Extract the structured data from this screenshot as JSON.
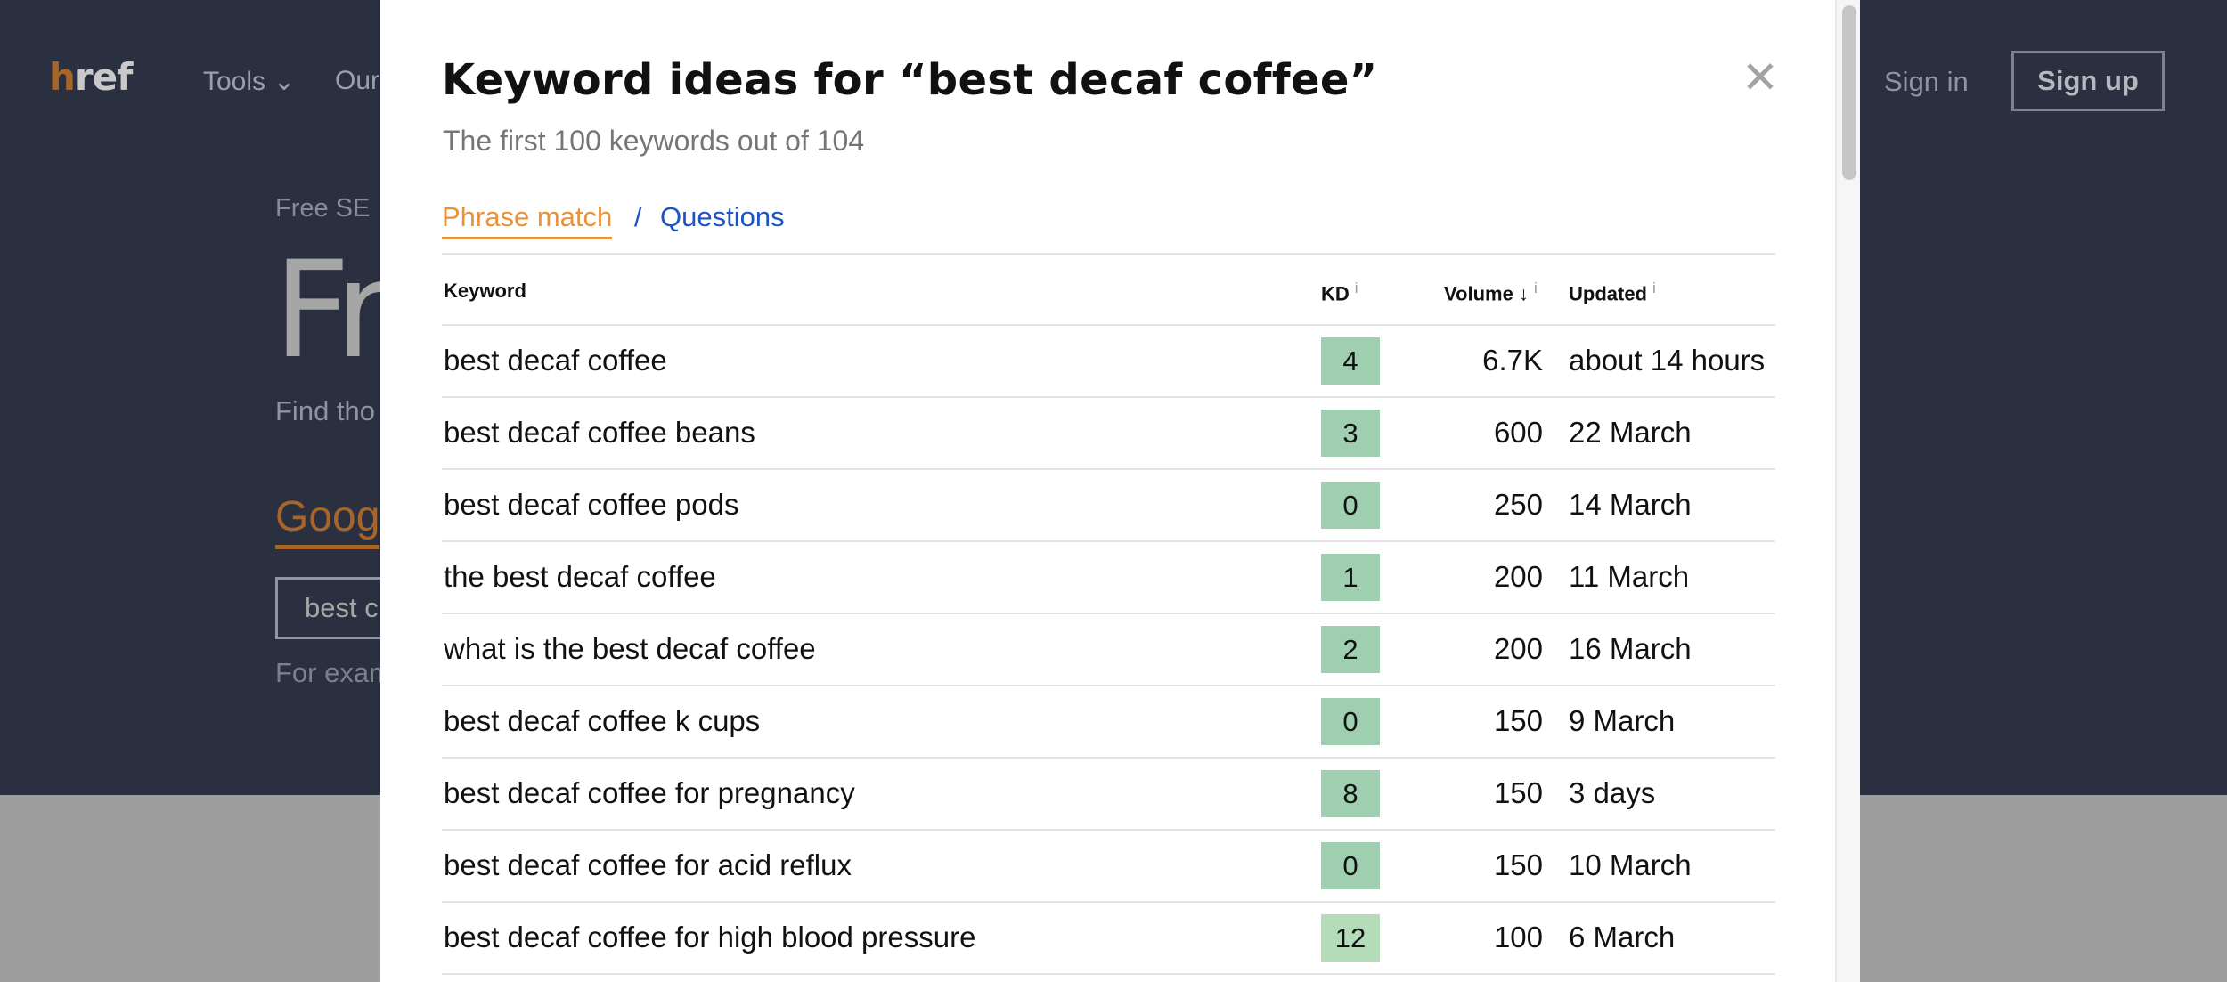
{
  "background": {
    "logo_accent": "h",
    "logo_rest": "ref",
    "nav_tools": "Tools ⌄",
    "nav_our": "Our",
    "sign_in": "Sign in",
    "sign_up": "Sign up",
    "eyebrow": "Free SE",
    "heading": "Fr",
    "description": "Find tho",
    "engine_tab": "Goog",
    "search_value": "best c",
    "example_text": "For exam"
  },
  "modal": {
    "title": "Keyword ideas for “best decaf coffee”",
    "subtitle": "The first 100 keywords out of 104",
    "close_glyph": "✕",
    "tabs": {
      "phrase_match": "Phrase match",
      "separator": "/",
      "questions": "Questions"
    },
    "table": {
      "headers": {
        "keyword": "Keyword",
        "kd": "KD",
        "volume": "Volume ↓",
        "updated": "Updated",
        "info": "i"
      },
      "rows": [
        {
          "keyword": "best decaf coffee",
          "kd": "4",
          "volume": "6.7K",
          "updated": "about 14 hours",
          "kd_color": "#9fcfb0"
        },
        {
          "keyword": "best decaf coffee beans",
          "kd": "3",
          "volume": "600",
          "updated": "22 March",
          "kd_color": "#9fcfb0"
        },
        {
          "keyword": "best decaf coffee pods",
          "kd": "0",
          "volume": "250",
          "updated": "14 March",
          "kd_color": "#9fcfb0"
        },
        {
          "keyword": "the best decaf coffee",
          "kd": "1",
          "volume": "200",
          "updated": "11 March",
          "kd_color": "#9fcfb0"
        },
        {
          "keyword": "what is the best decaf coffee",
          "kd": "2",
          "volume": "200",
          "updated": "16 March",
          "kd_color": "#9fcfb0"
        },
        {
          "keyword": "best decaf coffee k cups",
          "kd": "0",
          "volume": "150",
          "updated": "9 March",
          "kd_color": "#9fcfb0"
        },
        {
          "keyword": "best decaf coffee for pregnancy",
          "kd": "8",
          "volume": "150",
          "updated": "3 days",
          "kd_color": "#9fcfb0"
        },
        {
          "keyword": "best decaf coffee for acid reflux",
          "kd": "0",
          "volume": "150",
          "updated": "10 March",
          "kd_color": "#9fcfb0"
        },
        {
          "keyword": "best decaf coffee for high blood pressure",
          "kd": "12",
          "volume": "100",
          "updated": "6 March",
          "kd_color": "#b4dcb9"
        }
      ]
    }
  }
}
